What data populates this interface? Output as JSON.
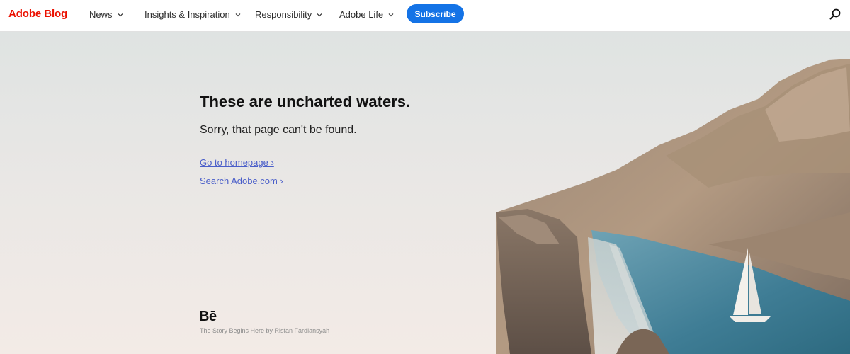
{
  "brand": {
    "label": "Adobe Blog",
    "color": "#eb1000"
  },
  "nav": {
    "items": [
      {
        "label": "News",
        "icon": "chevron-down-icon"
      },
      {
        "label": "Insights & Inspiration",
        "icon": "chevron-down-icon"
      },
      {
        "label": "Responsibility",
        "icon": "chevron-down-icon"
      },
      {
        "label": "Adobe Life",
        "icon": "chevron-down-icon"
      }
    ],
    "subscribe_label": "Subscribe",
    "subscribe_color": "#1473e6",
    "search_icon": "search-icon"
  },
  "main": {
    "headline": "These are uncharted waters.",
    "subline": "Sorry, that page can't be found.",
    "links": [
      {
        "label": "Go to homepage ›"
      },
      {
        "label": "Search Adobe.com ›"
      }
    ]
  },
  "footer": {
    "behance_logo": "Bē",
    "credit": "The Story Begins Here by Risfan Fardiansyah"
  }
}
